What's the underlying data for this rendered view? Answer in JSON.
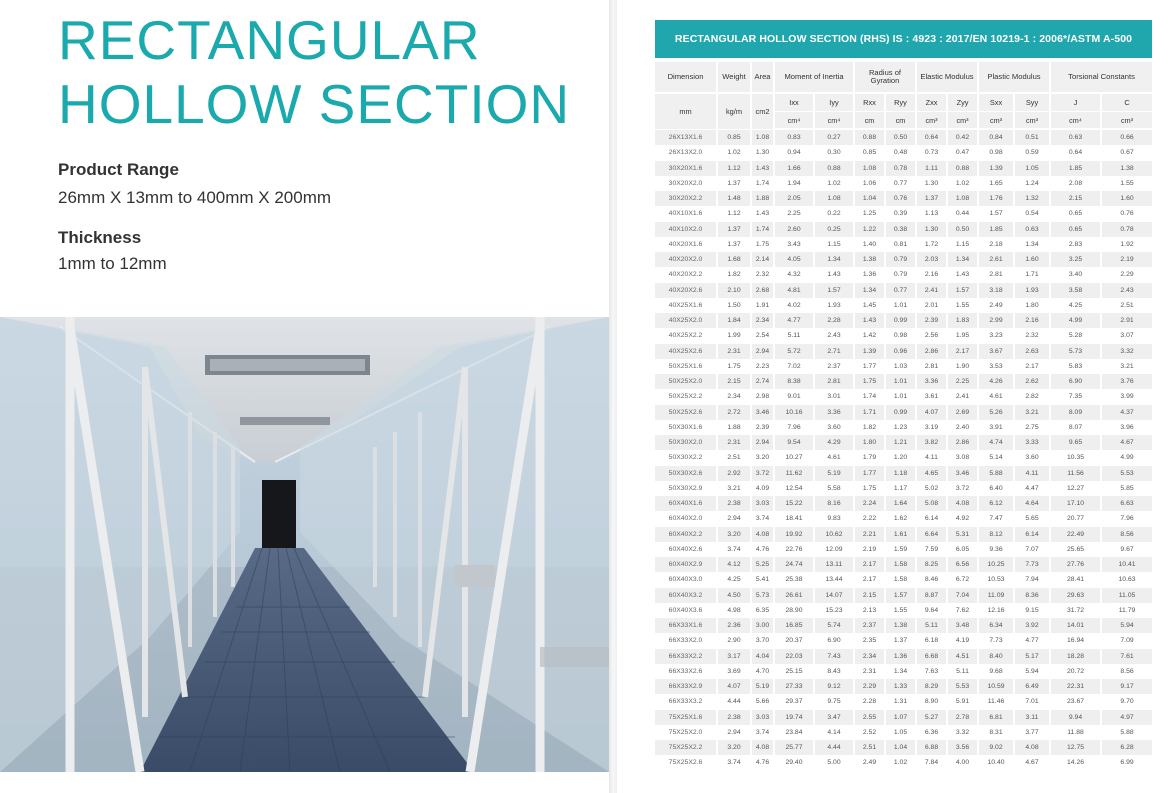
{
  "left": {
    "title_line1": "RECTANGULAR",
    "title_line2": "HOLLOW SECTION",
    "product_range_heading": "Product Range",
    "product_range_value": "26mm X 13mm to 400mm X 200mm",
    "thickness_heading": "Thickness",
    "thickness_value": "1mm to 12mm"
  },
  "table": {
    "title": "RECTANGULAR HOLLOW SECTION (RHS) IS : 4923 : 2017/EN 10219-1 : 2006*/ASTM A-500",
    "headers": {
      "dimension": "Dimension",
      "weight": "Weight",
      "area": "Area",
      "moment": "Moment of Inertia",
      "radius": "Radius of Gyration",
      "elastic": "Elastic Modulus",
      "plastic": "Plastic Modulus",
      "torsional": "Torsional Constants"
    },
    "subheaders": {
      "ixx": "Ixx",
      "iyy": "Iyy",
      "rxx": "Rxx",
      "ryy": "Ryy",
      "zxx": "Zxx",
      "zyy": "Zyy",
      "sxx": "Sxx",
      "syy": "Syy",
      "j": "J",
      "c": "C"
    },
    "units": {
      "dim": "mm",
      "weight": "kg/m",
      "area": "cm2",
      "ixx": "cm⁴",
      "iyy": "cm⁴",
      "rxx": "cm",
      "ryy": "cm",
      "zxx": "cm³",
      "zyy": "cm³",
      "sxx": "cm³",
      "syy": "cm³",
      "j": "cm⁴",
      "c": "cm³"
    },
    "rows": [
      [
        "26X13X1.6",
        "0.85",
        "1.08",
        "0.83",
        "0.27",
        "0.88",
        "0.50",
        "0.64",
        "0.42",
        "0.84",
        "0.51",
        "0.63",
        "0.66"
      ],
      [
        "26X13X2.0",
        "1.02",
        "1.30",
        "0.94",
        "0.30",
        "0.85",
        "0.48",
        "0.73",
        "0.47",
        "0.98",
        "0.59",
        "0.64",
        "0.67"
      ],
      [
        "30X20X1.6",
        "1.12",
        "1.43",
        "1.66",
        "0.88",
        "1.08",
        "0.78",
        "1.11",
        "0.88",
        "1.39",
        "1.05",
        "1.85",
        "1.38"
      ],
      [
        "30X20X2.0",
        "1.37",
        "1.74",
        "1.94",
        "1.02",
        "1.06",
        "0.77",
        "1.30",
        "1.02",
        "1.65",
        "1.24",
        "2.08",
        "1.55"
      ],
      [
        "30X20X2.2",
        "1.48",
        "1.88",
        "2.05",
        "1.08",
        "1.04",
        "0.76",
        "1.37",
        "1.08",
        "1.76",
        "1.32",
        "2.15",
        "1.60"
      ],
      [
        "40X10X1.6",
        "1.12",
        "1.43",
        "2.25",
        "0.22",
        "1.25",
        "0.39",
        "1.13",
        "0.44",
        "1.57",
        "0.54",
        "0.65",
        "0.76"
      ],
      [
        "40X10X2.0",
        "1.37",
        "1.74",
        "2.60",
        "0.25",
        "1.22",
        "0.38",
        "1.30",
        "0.50",
        "1.85",
        "0.63",
        "0.65",
        "0.78"
      ],
      [
        "40X20X1.6",
        "1.37",
        "1.75",
        "3.43",
        "1.15",
        "1.40",
        "0.81",
        "1.72",
        "1.15",
        "2.18",
        "1.34",
        "2.83",
        "1.92"
      ],
      [
        "40X20X2.0",
        "1.68",
        "2.14",
        "4.05",
        "1.34",
        "1.38",
        "0.79",
        "2.03",
        "1.34",
        "2.61",
        "1.60",
        "3.25",
        "2.19"
      ],
      [
        "40X20X2.2",
        "1.82",
        "2.32",
        "4.32",
        "1.43",
        "1.36",
        "0.79",
        "2.16",
        "1.43",
        "2.81",
        "1.71",
        "3.40",
        "2.29"
      ],
      [
        "40X20X2.6",
        "2.10",
        "2.68",
        "4.81",
        "1.57",
        "1.34",
        "0.77",
        "2.41",
        "1.57",
        "3.18",
        "1.93",
        "3.58",
        "2.43"
      ],
      [
        "40X25X1.6",
        "1.50",
        "1.91",
        "4.02",
        "1.93",
        "1.45",
        "1.01",
        "2.01",
        "1.55",
        "2.49",
        "1.80",
        "4.25",
        "2.51"
      ],
      [
        "40X25X2.0",
        "1.84",
        "2.34",
        "4.77",
        "2.28",
        "1.43",
        "0.99",
        "2.39",
        "1.83",
        "2.99",
        "2.16",
        "4.99",
        "2.91"
      ],
      [
        "40X25X2.2",
        "1.99",
        "2.54",
        "5.11",
        "2.43",
        "1.42",
        "0.98",
        "2.56",
        "1.95",
        "3.23",
        "2.32",
        "5.28",
        "3.07"
      ],
      [
        "40X25X2.6",
        "2.31",
        "2.94",
        "5.72",
        "2.71",
        "1.39",
        "0.96",
        "2.86",
        "2.17",
        "3.67",
        "2.63",
        "5.73",
        "3.32"
      ],
      [
        "50X25X1.6",
        "1.75",
        "2.23",
        "7.02",
        "2.37",
        "1.77",
        "1.03",
        "2.81",
        "1.90",
        "3.53",
        "2.17",
        "5.83",
        "3.21"
      ],
      [
        "50X25X2.0",
        "2.15",
        "2.74",
        "8.38",
        "2.81",
        "1.75",
        "1.01",
        "3.36",
        "2.25",
        "4.26",
        "2.62",
        "6.90",
        "3.76"
      ],
      [
        "50X25X2.2",
        "2.34",
        "2.98",
        "9.01",
        "3.01",
        "1.74",
        "1.01",
        "3.61",
        "2.41",
        "4.61",
        "2.82",
        "7.35",
        "3.99"
      ],
      [
        "50X25X2.6",
        "2.72",
        "3.46",
        "10.16",
        "3.36",
        "1.71",
        "0.99",
        "4.07",
        "2.69",
        "5.26",
        "3.21",
        "8.09",
        "4.37"
      ],
      [
        "50X30X1.6",
        "1.88",
        "2.39",
        "7.96",
        "3.60",
        "1.82",
        "1.23",
        "3.19",
        "2.40",
        "3.91",
        "2.75",
        "8.07",
        "3.96"
      ],
      [
        "50X30X2.0",
        "2.31",
        "2.94",
        "9.54",
        "4.29",
        "1.80",
        "1.21",
        "3.82",
        "2.86",
        "4.74",
        "3.33",
        "9.65",
        "4.67"
      ],
      [
        "50X30X2.2",
        "2.51",
        "3.20",
        "10.27",
        "4.61",
        "1.79",
        "1.20",
        "4.11",
        "3.08",
        "5.14",
        "3.60",
        "10.35",
        "4.99"
      ],
      [
        "50X30X2.6",
        "2.92",
        "3.72",
        "11.62",
        "5.19",
        "1.77",
        "1.18",
        "4.65",
        "3.46",
        "5.88",
        "4.11",
        "11.56",
        "5.53"
      ],
      [
        "50X30X2.9",
        "3.21",
        "4.09",
        "12.54",
        "5.58",
        "1.75",
        "1.17",
        "5.02",
        "3.72",
        "6.40",
        "4.47",
        "12.27",
        "5.85"
      ],
      [
        "60X40X1.6",
        "2.38",
        "3.03",
        "15.22",
        "8.16",
        "2.24",
        "1.64",
        "5.08",
        "4.08",
        "6.12",
        "4.64",
        "17.10",
        "6.63"
      ],
      [
        "60X40X2.0",
        "2.94",
        "3.74",
        "18.41",
        "9.83",
        "2.22",
        "1.62",
        "6.14",
        "4.92",
        "7.47",
        "5.65",
        "20.77",
        "7.96"
      ],
      [
        "60X40X2.2",
        "3.20",
        "4.08",
        "19.92",
        "10.62",
        "2.21",
        "1.61",
        "6.64",
        "5.31",
        "8.12",
        "6.14",
        "22.49",
        "8.56"
      ],
      [
        "60X40X2.6",
        "3.74",
        "4.76",
        "22.76",
        "12.09",
        "2.19",
        "1.59",
        "7.59",
        "6.05",
        "9.36",
        "7.07",
        "25.65",
        "9.67"
      ],
      [
        "60X40X2.9",
        "4.12",
        "5.25",
        "24.74",
        "13.11",
        "2.17",
        "1.58",
        "8.25",
        "6.56",
        "10.25",
        "7.73",
        "27.76",
        "10.41"
      ],
      [
        "60X40X3.0",
        "4.25",
        "5.41",
        "25.38",
        "13.44",
        "2.17",
        "1.58",
        "8.46",
        "6.72",
        "10.53",
        "7.94",
        "28.41",
        "10.63"
      ],
      [
        "60X40X3.2",
        "4.50",
        "5.73",
        "26.61",
        "14.07",
        "2.15",
        "1.57",
        "8.87",
        "7.04",
        "11.09",
        "8.36",
        "29.63",
        "11.05"
      ],
      [
        "60X40X3.6",
        "4.98",
        "6.35",
        "28.90",
        "15.23",
        "2.13",
        "1.55",
        "9.64",
        "7.62",
        "12.16",
        "9.15",
        "31.72",
        "11.79"
      ],
      [
        "66X33X1.6",
        "2.36",
        "3.00",
        "16.85",
        "5.74",
        "2.37",
        "1.38",
        "5.11",
        "3.48",
        "6.34",
        "3.92",
        "14.01",
        "5.94"
      ],
      [
        "66X33X2.0",
        "2.90",
        "3.70",
        "20.37",
        "6.90",
        "2.35",
        "1.37",
        "6.18",
        "4.19",
        "7.73",
        "4.77",
        "16.94",
        "7.09"
      ],
      [
        "66X33X2.2",
        "3.17",
        "4.04",
        "22.03",
        "7.43",
        "2.34",
        "1.36",
        "6.68",
        "4.51",
        "8.40",
        "5.17",
        "18.28",
        "7.61"
      ],
      [
        "66X33X2.6",
        "3.69",
        "4.70",
        "25.15",
        "8.43",
        "2.31",
        "1.34",
        "7.63",
        "5.11",
        "9.68",
        "5.94",
        "20.72",
        "8.56"
      ],
      [
        "66X33X2.9",
        "4.07",
        "5.19",
        "27.33",
        "9.12",
        "2.29",
        "1.33",
        "8.29",
        "5.53",
        "10.59",
        "6.49",
        "22.31",
        "9.17"
      ],
      [
        "66X33X3.2",
        "4.44",
        "5.66",
        "29.37",
        "9.75",
        "2.28",
        "1.31",
        "8.90",
        "5.91",
        "11.46",
        "7.01",
        "23.67",
        "9.70"
      ],
      [
        "75X25X1.6",
        "2.38",
        "3.03",
        "19.74",
        "3.47",
        "2.55",
        "1.07",
        "5.27",
        "2.78",
        "6.81",
        "3.11",
        "9.94",
        "4.97"
      ],
      [
        "75X25X2.0",
        "2.94",
        "3.74",
        "23.84",
        "4.14",
        "2.52",
        "1.05",
        "6.36",
        "3.32",
        "8.31",
        "3.77",
        "11.88",
        "5.88"
      ],
      [
        "75X25X2.2",
        "3.20",
        "4.08",
        "25.77",
        "4.44",
        "2.51",
        "1.04",
        "6.88",
        "3.56",
        "9.02",
        "4.08",
        "12.75",
        "6.28"
      ],
      [
        "75X25X2.6",
        "3.74",
        "4.76",
        "29.40",
        "5.00",
        "2.49",
        "1.02",
        "7.84",
        "4.00",
        "10.40",
        "4.67",
        "14.26",
        "6.99"
      ]
    ]
  }
}
